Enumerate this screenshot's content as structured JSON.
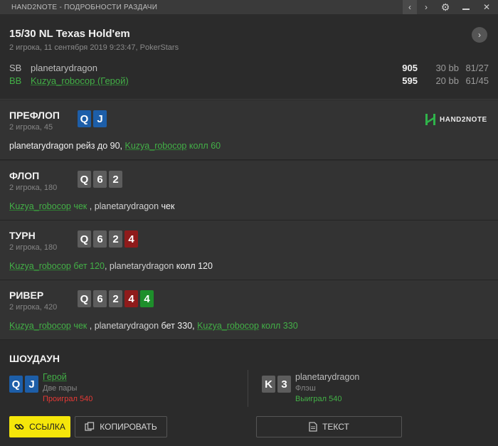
{
  "window": {
    "title": "HAND2NOTE - ПОДРОБНОСТИ РАЗДАЧИ",
    "prev_glyph": "‹",
    "next_glyph": "›",
    "gear_glyph": "⚙",
    "close_glyph": "✕"
  },
  "hand": {
    "title": "15/30 NL Texas Hold'em",
    "subtitle": "2 игрока, 11 сентября 2019 9:23:47, PokerStars",
    "next_glyph": "›"
  },
  "players": [
    {
      "position": "SB",
      "name": "planetarydragon",
      "stack": "905",
      "bb": "30 bb",
      "ratio": "81/27"
    },
    {
      "position": "BB",
      "name": "Kuzya_robocop (Герой)",
      "stack": "595",
      "bb": "20 bb",
      "ratio": "61/45"
    }
  ],
  "logo_text": "HAND2NOTE",
  "streets": {
    "preflop": {
      "name": "ПРЕФЛОП",
      "info": "2 игрока, 45",
      "cards": [
        "Q",
        "J"
      ],
      "p1": "planetarydragon",
      "p1_action": " рейз до 90, ",
      "p2": "Kuzya_robocop",
      "p2_action": " колл 60"
    },
    "flop": {
      "name": "ФЛОП",
      "info": "2 игрока, 180",
      "cards": [
        "Q",
        "6",
        "2"
      ],
      "p1": "Kuzya_robocop",
      "p1_action": " чек",
      "sep": " , ",
      "p2": "planetarydragon",
      "p2_action": " чек"
    },
    "turn": {
      "name": "ТУРН",
      "info": "2 игрока, 180",
      "cards": [
        "Q",
        "6",
        "2",
        "4"
      ],
      "p1": "Kuzya_robocop",
      "p1_action": " бет 120",
      "sep": ", ",
      "p2": "planetarydragon",
      "p2_action": " колл 120"
    },
    "river": {
      "name": "РИВЕР",
      "info": "2 игрока, 420",
      "cards": [
        "Q",
        "6",
        "2",
        "4",
        "4"
      ],
      "p1": "Kuzya_robocop",
      "p1_action": " чек",
      "sep1": " , ",
      "p2": "planetarydragon",
      "p2_action": " бет 330, ",
      "p3": "Kuzya_robocop",
      "p3_action": " колл 330"
    }
  },
  "showdown": {
    "title": "ШОУДАУН",
    "hero": {
      "cards": [
        "Q",
        "J"
      ],
      "name": "Герой",
      "combo": "Две пары",
      "result": "Проиграл 540"
    },
    "villain": {
      "cards": [
        "K",
        "3"
      ],
      "name": "planetarydragon",
      "combo": "Флэш",
      "result": "Выиграл 540"
    }
  },
  "buttons": {
    "link": "ССЫЛКА",
    "copy": "КОПИРОВАТЬ",
    "text": "ТЕКСТ"
  },
  "colors": {
    "accent_yellow": "#f5e60a",
    "hero_green": "#43b047",
    "lost_red": "#e53935",
    "card_blue": "#1d5ea8",
    "card_red": "#8f1b1b",
    "card_green": "#1e8f2b",
    "card_grey": "#5d5d5d"
  }
}
